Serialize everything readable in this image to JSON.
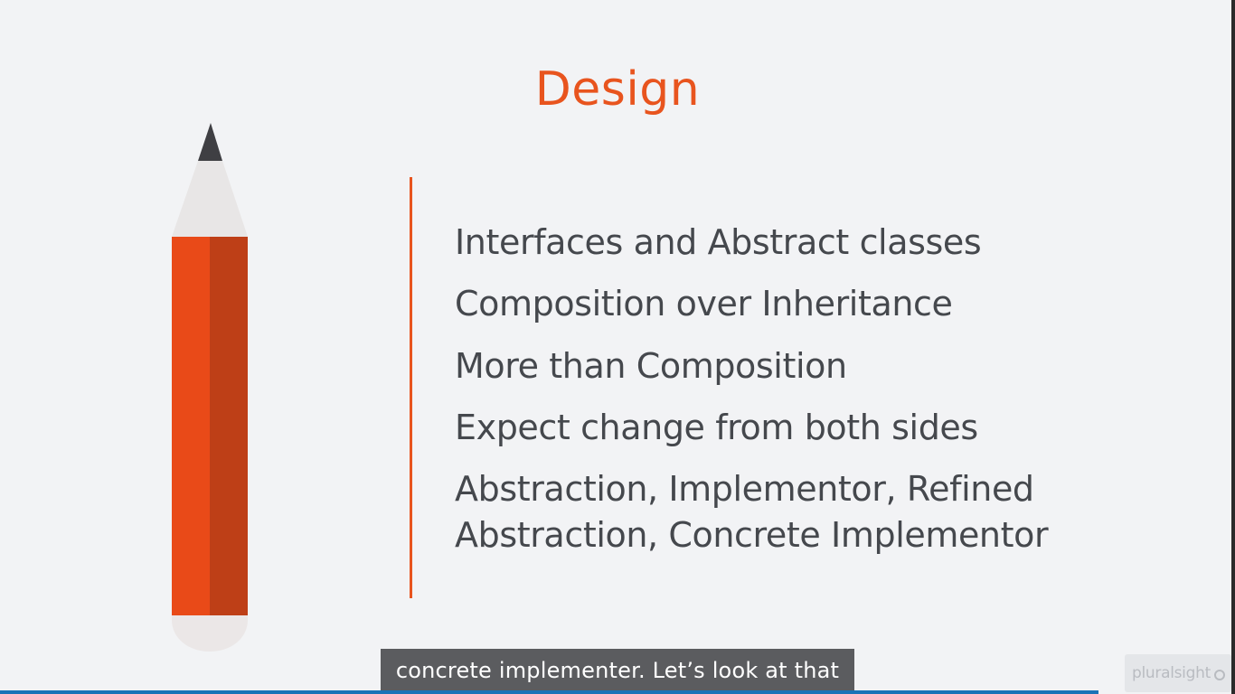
{
  "slide": {
    "title": "Design",
    "bullets": [
      "Interfaces and Abstract classes",
      "Composition over Inheritance",
      "More than Composition",
      "Expect change from both sides",
      "Abstraction, Implementor, Refined Abstraction, Concrete Implementor"
    ]
  },
  "caption": {
    "text": "concrete implementer. Let’s look at that"
  },
  "logo": {
    "text": "pluralsight",
    "icon": "pluralsight-logo-icon"
  },
  "illustration": {
    "icon": "pencil-icon"
  },
  "colors": {
    "accent": "#e8541e",
    "text": "#45484d",
    "background": "#f2f3f5",
    "caption_bg": "#5b5c5f",
    "progress": "#1a73b7"
  }
}
